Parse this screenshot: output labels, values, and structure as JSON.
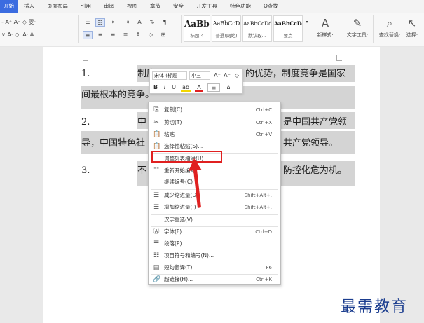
{
  "tabs": [
    {
      "label": "开始",
      "active": true
    },
    {
      "label": "插入"
    },
    {
      "label": "页面布局"
    },
    {
      "label": "引用"
    },
    {
      "label": "审阅"
    },
    {
      "label": "视图"
    },
    {
      "label": "章节"
    },
    {
      "label": "安全"
    },
    {
      "label": "开发工具"
    },
    {
      "label": "特色功能"
    },
    {
      "label": "Q查找"
    }
  ],
  "ribbon": {
    "row1_left": "- A⁺ A⁻ ◇ 雯·",
    "row2_left": "∨ A· ◇· A· A",
    "styles": [
      {
        "sample": "AaBbC",
        "name": "标题 4"
      },
      {
        "sample": "AaBbCcD",
        "name": "普通(网站)"
      },
      {
        "sample": "AaBbCcDd",
        "name": "默认段..."
      },
      {
        "sample": "AaBbCcDc",
        "name": "要点"
      }
    ],
    "new_style": "新样式·",
    "text_tool": "文字工具·",
    "find_replace": "查找替换·",
    "select": "选择·"
  },
  "document": {
    "p1_num": "1.",
    "p1_line1": "制度",
    "p1_line1_right": "的优势，制度竞争是国家",
    "p1_line2": "间最根本的竞争。",
    "p2_num": "2.",
    "p2_line1_start": "中",
    "p2_line1_right": "是中国共产党领",
    "p2_line2_start": "导，中国特色社",
    "p2_line2_right": "共产党领导。",
    "p3_num": "3.",
    "p3_line1_start": "不",
    "p3_line1_right": "防控化危为机。"
  },
  "mini_toolbar": {
    "font": "宋体 (标题",
    "size": "小三",
    "grow": "A⁺",
    "shrink": "A⁻",
    "clear": "◇",
    "bold": "B",
    "italic": "I",
    "underline": "U",
    "highlight": "ab",
    "font_color": "A",
    "align": "≡",
    "para_icon": "⌂"
  },
  "context_menu": {
    "items": [
      {
        "icon": "⎘",
        "label": "复制(C)",
        "shortcut": "Ctrl+C"
      },
      {
        "icon": "✂",
        "label": "剪切(T)",
        "shortcut": "Ctrl+X"
      },
      {
        "icon": "📋",
        "label": "粘贴",
        "shortcut": "Ctrl+V"
      },
      {
        "icon": "📋",
        "label": "选择性粘贴(S)...",
        "shortcut": ""
      },
      {
        "icon": "",
        "label": "调整列表缩进(U)...",
        "shortcut": ""
      },
      {
        "icon": "☷",
        "label": "重新开始编号",
        "shortcut": ""
      },
      {
        "icon": "",
        "label": "继续编号(C)",
        "shortcut": ""
      },
      {
        "icon": "☰",
        "label": "减少缩进量(D)",
        "shortcut": "Shift+Alt+."
      },
      {
        "icon": "☰",
        "label": "增加缩进量(I)",
        "shortcut": "Shift+Alt+."
      },
      {
        "icon": "",
        "label": "汉字重选(V)",
        "shortcut": ""
      },
      {
        "icon": "Ⓐ",
        "label": "字体(F)...",
        "shortcut": "Ctrl+D"
      },
      {
        "icon": "☰",
        "label": "段落(P)...",
        "shortcut": ""
      },
      {
        "icon": "☷",
        "label": "项目符号和编号(N)...",
        "shortcut": ""
      },
      {
        "icon": "▤",
        "label": "短句翻译(T)",
        "shortcut": "F6"
      },
      {
        "icon": "🔗",
        "label": "超链接(H)...",
        "shortcut": "Ctrl+K"
      }
    ]
  },
  "watermark": "最需教育",
  "colors": {
    "accent": "#3b6ce0",
    "annotation": "#e02020",
    "selection": "#d4d4d4"
  }
}
